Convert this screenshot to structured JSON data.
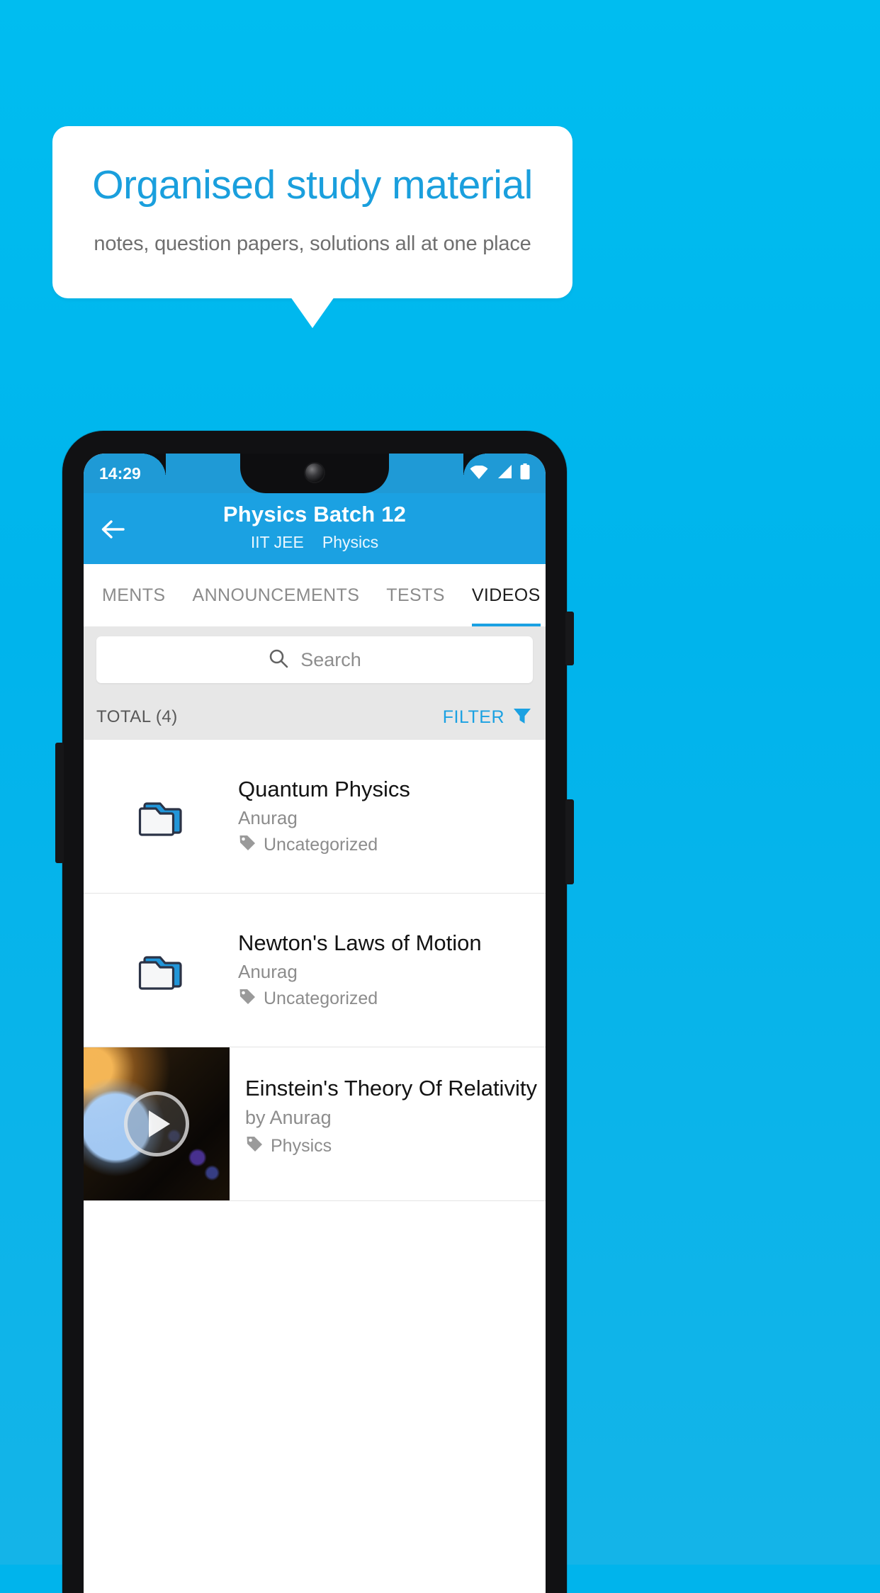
{
  "promo": {
    "title": "Organised study material",
    "subtitle": "notes, question papers, solutions all at one place",
    "title_color": "#1a9fdd",
    "background_color": "#00b4ec"
  },
  "phone": {
    "status_bar": {
      "time": "14:29",
      "icons": [
        "wifi-icon",
        "signal-icon",
        "battery-icon"
      ]
    },
    "app_bar": {
      "back_icon": "back-arrow-icon",
      "title": "Physics Batch 12",
      "subtitle_primary": "IIT JEE",
      "subtitle_secondary": "Physics",
      "color": "#1ba1e2"
    },
    "tabs": {
      "items": [
        {
          "label": "MENTS",
          "active": false
        },
        {
          "label": "ANNOUNCEMENTS",
          "active": false
        },
        {
          "label": "TESTS",
          "active": false
        },
        {
          "label": "VIDEOS",
          "active": true
        }
      ],
      "indicator_color": "#1ba1e2"
    },
    "search": {
      "placeholder": "Search",
      "icon": "search-icon"
    },
    "toolbar": {
      "total_label": "TOTAL (4)",
      "filter_label": "FILTER",
      "filter_icon": "filter-funnel-icon",
      "filter_color": "#1ba1e2"
    },
    "list": {
      "items": [
        {
          "type": "folder",
          "icon": "folder-icon",
          "title": "Quantum Physics",
          "author": "Anurag",
          "tag_icon": "tag-icon",
          "tag": "Uncategorized"
        },
        {
          "type": "folder",
          "icon": "folder-icon",
          "title": "Newton's Laws of Motion",
          "author": "Anurag",
          "tag_icon": "tag-icon",
          "tag": "Uncategorized"
        },
        {
          "type": "video",
          "icon": "play-icon",
          "title": "Einstein's Theory Of Relativity",
          "author": "by Anurag",
          "tag_icon": "tag-icon",
          "tag": "Physics"
        }
      ]
    }
  }
}
